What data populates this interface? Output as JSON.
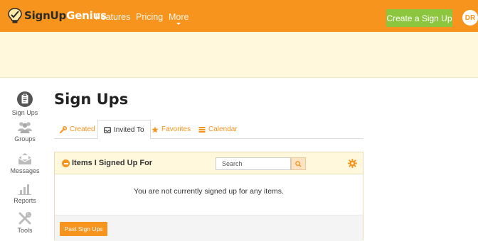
{
  "header": {
    "logo_main": "SignUp",
    "logo_accent": "Genius",
    "nav": [
      {
        "label": "Features"
      },
      {
        "label": "Pricing"
      },
      {
        "label": "More"
      }
    ],
    "create_label": "Create a Sign Up",
    "avatar_initials": "DR"
  },
  "sidebar": {
    "items": [
      {
        "label": "Sign Ups",
        "icon": "clipboard-icon",
        "active": true
      },
      {
        "label": "Groups",
        "icon": "groups-icon"
      },
      {
        "label": "Messages",
        "icon": "envelope-icon"
      },
      {
        "label": "Reports",
        "icon": "bar-chart-icon"
      },
      {
        "label": "Tools",
        "icon": "tools-icon"
      }
    ]
  },
  "main": {
    "title": "Sign Ups",
    "tabs": [
      {
        "label": "Created",
        "icon": "wrench-icon"
      },
      {
        "label": "Invited To",
        "icon": "inbox-icon",
        "active": true
      },
      {
        "label": "Favorites",
        "icon": "star-icon"
      },
      {
        "label": "Calendar",
        "icon": "calendar-icon"
      }
    ],
    "panel": {
      "title": "Items I Signed Up For",
      "search_placeholder": "Search",
      "empty_message": "You are not currently signed up for any items.",
      "past_button": "Past Sign Ups"
    }
  },
  "colors": {
    "brand_orange": "#f7941d",
    "create_green": "#8cc63f",
    "banner_bg": "#fff8dc"
  }
}
